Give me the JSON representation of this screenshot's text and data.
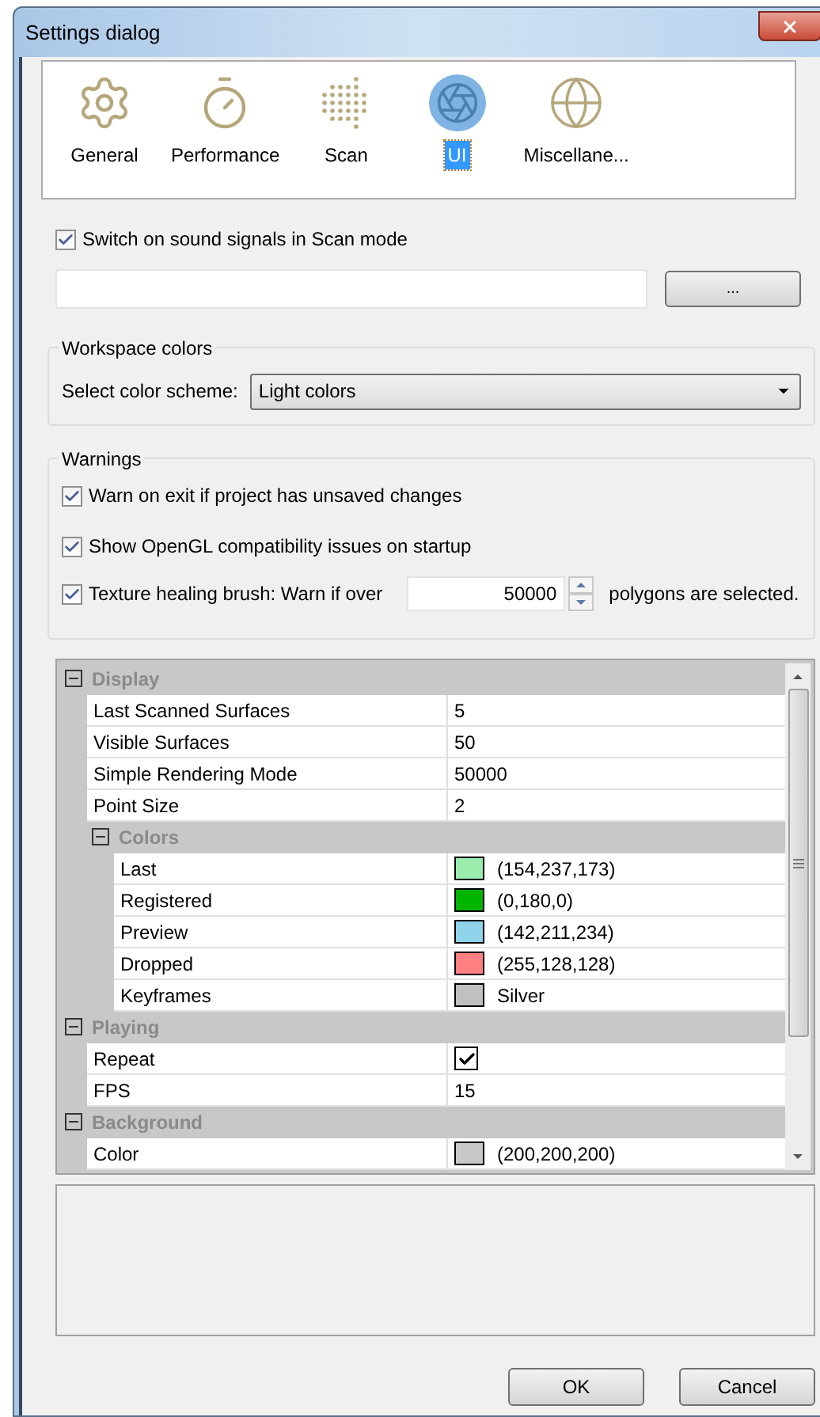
{
  "window": {
    "title": "Settings dialog"
  },
  "categories": [
    {
      "label": "General",
      "kind": "gear",
      "selected": false
    },
    {
      "label": "Performance",
      "kind": "stopwatch",
      "selected": false
    },
    {
      "label": "Scan",
      "kind": "dots",
      "selected": false
    },
    {
      "label": "UI",
      "kind": "aperture",
      "selected": true
    },
    {
      "label": "Miscellane...",
      "kind": "globe",
      "selected": false
    }
  ],
  "sound_signals": {
    "label": "Switch on sound signals in Scan mode",
    "checked": true
  },
  "browse_button": {
    "label": "..."
  },
  "workspace_colors": {
    "title": "Workspace colors",
    "label": "Select color scheme:",
    "value": "Light colors"
  },
  "warnings": {
    "title": "Warnings",
    "items": [
      {
        "kind": "checkbox",
        "label": "Warn on exit if project has unsaved changes",
        "checked": true
      },
      {
        "kind": "checkbox",
        "label": "Show OpenGL compatibility issues on startup",
        "checked": true
      },
      {
        "kind": "spin",
        "label": "Texture healing brush: Warn if over",
        "checked": true,
        "value": "50000",
        "suffix": "polygons are selected."
      }
    ]
  },
  "property_grid": [
    {
      "kind": "group",
      "label": "Display",
      "expanded": true,
      "children": [
        {
          "kind": "text",
          "name": "Last Scanned Surfaces",
          "value": "5"
        },
        {
          "kind": "text",
          "name": "Visible Surfaces",
          "value": "50"
        },
        {
          "kind": "text",
          "name": "Simple Rendering Mode",
          "value": "50000"
        },
        {
          "kind": "text",
          "name": "Point Size",
          "value": "2"
        },
        {
          "kind": "group",
          "label": "Colors",
          "expanded": true,
          "children": [
            {
              "kind": "color",
              "name": "Last",
              "value": "(154,237,173)",
              "color": "#9aedad"
            },
            {
              "kind": "color",
              "name": "Registered",
              "value": "(0,180,0)",
              "color": "#00b400"
            },
            {
              "kind": "color",
              "name": "Preview",
              "value": "(142,211,234)",
              "color": "#8ed3ea"
            },
            {
              "kind": "color",
              "name": "Dropped",
              "value": "(255,128,128)",
              "color": "#ff8080"
            },
            {
              "kind": "color",
              "name": "Keyframes",
              "value": "Silver",
              "color": "#c0c0c0"
            }
          ]
        }
      ]
    },
    {
      "kind": "group",
      "label": "Playing",
      "expanded": true,
      "children": [
        {
          "kind": "checkbox",
          "name": "Repeat",
          "checked": true
        },
        {
          "kind": "text",
          "name": "FPS",
          "value": "15"
        }
      ]
    },
    {
      "kind": "group",
      "label": "Background",
      "expanded": true,
      "children": [
        {
          "kind": "color",
          "name": "Color",
          "value": "(200,200,200)",
          "color": "#c8c8c8"
        }
      ]
    }
  ],
  "buttons": [
    {
      "label": "OK"
    },
    {
      "label": "Cancel"
    }
  ]
}
